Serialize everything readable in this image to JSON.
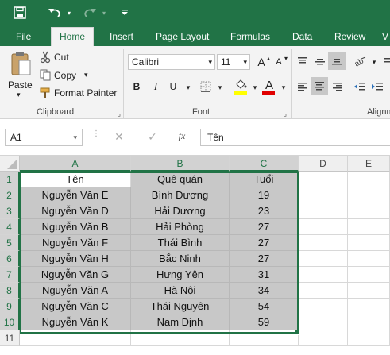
{
  "qat": {
    "save_icon": "save-icon",
    "undo_icon": "undo-icon",
    "redo_icon": "redo-icon"
  },
  "tabs": [
    "File",
    "Home",
    "Insert",
    "Page Layout",
    "Formulas",
    "Data",
    "Review",
    "V"
  ],
  "active_tab": "Home",
  "clipboard": {
    "paste": "Paste",
    "cut": "Cut",
    "copy": "Copy",
    "format_painter": "Format Painter",
    "label": "Clipboard"
  },
  "font": {
    "name": "Calibri",
    "size": "11",
    "bold": "B",
    "italic": "I",
    "underline": "U",
    "grow": "A",
    "shrink": "A",
    "font_color_letter": "A",
    "highlight_color": "#ffff00",
    "font_color": "#e00000",
    "label": "Font"
  },
  "alignment": {
    "label": "Alignm"
  },
  "formula_bar": {
    "name_box": "A1",
    "fx": "fx",
    "value": "Tên"
  },
  "columns": [
    "A",
    "B",
    "C",
    "D",
    "E"
  ],
  "rows": [
    "1",
    "2",
    "3",
    "4",
    "5",
    "6",
    "7",
    "8",
    "9",
    "10",
    "11"
  ],
  "table": {
    "headers": [
      "Tên",
      "Quê quán",
      "Tuổi"
    ],
    "rows": [
      [
        "Nguyễn Văn E",
        "Bình Dương",
        "19"
      ],
      [
        "Nguyễn Văn D",
        "Hải Dương",
        "23"
      ],
      [
        "Nguyễn Văn B",
        "Hải Phòng",
        "27"
      ],
      [
        "Nguyễn Văn F",
        "Thái Bình",
        "27"
      ],
      [
        "Nguyễn Văn H",
        "Bắc Ninh",
        "27"
      ],
      [
        "Nguyễn Văn G",
        "Hưng Yên",
        "31"
      ],
      [
        "Nguyễn Văn A",
        "Hà Nội",
        "34"
      ],
      [
        "Nguyễn Văn C",
        "Thái Nguyên",
        "54"
      ],
      [
        "Nguyễn Văn K",
        "Nam Định",
        "59"
      ]
    ]
  },
  "colors": {
    "brand": "#217346",
    "cell_shade": "#c8c8c8"
  }
}
